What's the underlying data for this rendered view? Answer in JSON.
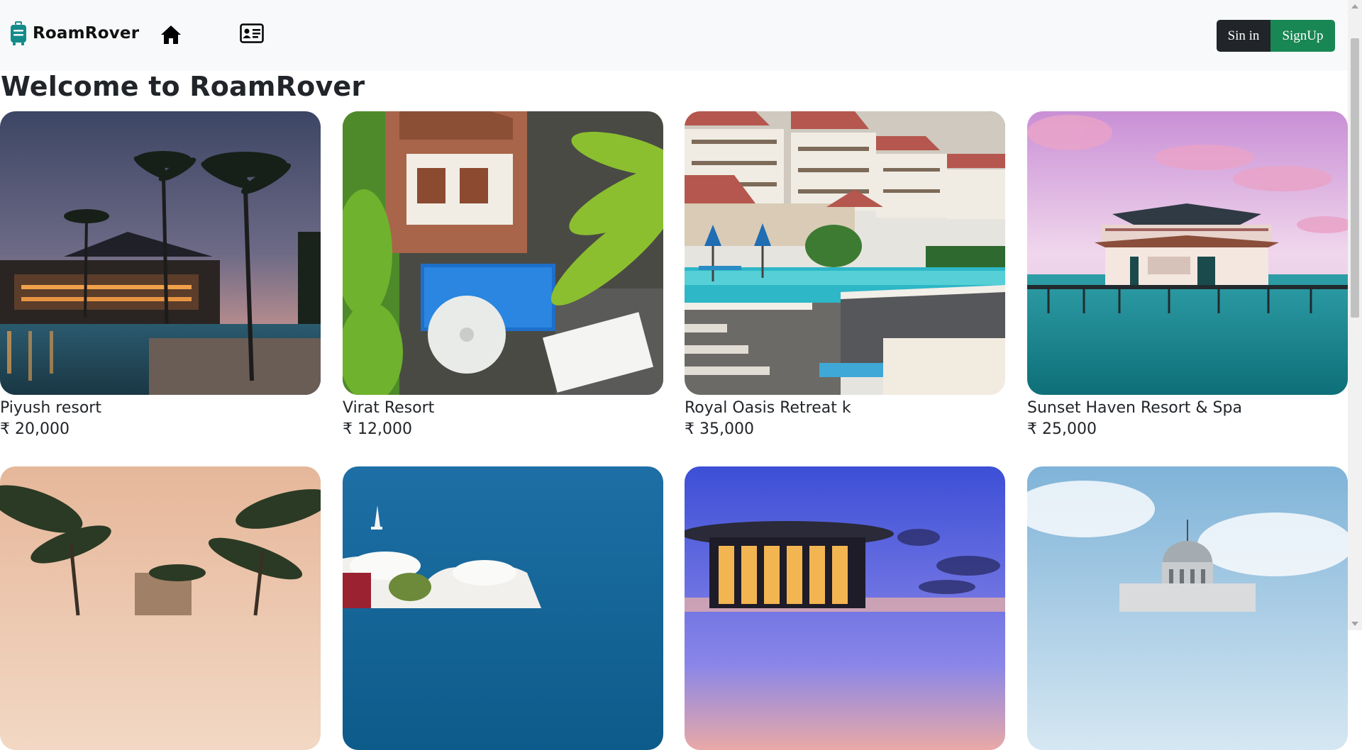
{
  "brand": {
    "name": "RoamRover",
    "icon": "luggage-icon",
    "color": "#138b8b"
  },
  "nav": {
    "home_icon": "home-icon",
    "card_icon": "contact-card-icon"
  },
  "auth": {
    "signin_label": "Sin in",
    "signup_label": "SignUp",
    "signin_color": "#212529",
    "signup_color": "#198754"
  },
  "page": {
    "title": "Welcome to RoamRover"
  },
  "listings": [
    {
      "name": "Piyush resort",
      "price": "₹ 20,000",
      "image": "night-pool-palms"
    },
    {
      "name": "Virat Resort",
      "price": "₹ 12,000",
      "image": "aerial-pool-palms"
    },
    {
      "name": "Royal Oasis Retreat k",
      "price": "₹ 35,000",
      "image": "infinity-pool-hotel"
    },
    {
      "name": "Sunset Haven Resort & Spa",
      "price": "₹ 25,000",
      "image": "overwater-villa-pink-sky"
    },
    {
      "name": "",
      "price": "",
      "image": "palm-trees-sunset"
    },
    {
      "name": "",
      "price": "",
      "image": "santorini-sea"
    },
    {
      "name": "",
      "price": "",
      "image": "round-pavilion-dusk"
    },
    {
      "name": "",
      "price": "",
      "image": "domed-palace"
    }
  ]
}
